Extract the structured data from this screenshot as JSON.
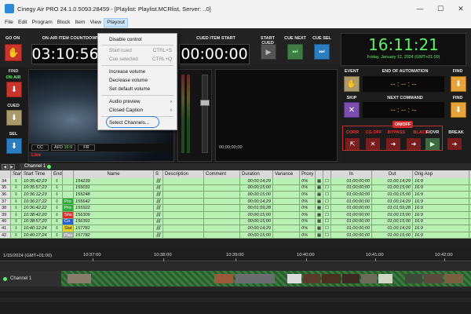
{
  "window": {
    "title": "Cinegy Air PRO 24.1.0.5093.28459 - [Playlist: Playlist.MCRlist, Server: ..0]",
    "minimize": "—",
    "maximize": "☐",
    "close": "✕"
  },
  "menu": [
    "File",
    "Edit",
    "Program",
    "Block",
    "Item",
    "View",
    "Playout"
  ],
  "toolbar": {
    "go_on": "GO ON",
    "on_air_countdown_label": "ON-AIR ITEM COUNTDOWN",
    "on_air_countdown": "03:10:56",
    "cued_start_label": "CUED ITEM START",
    "cued_start": "00:00:00",
    "start_cued": "START CUED",
    "cue_next": "CUE NEXT",
    "cue_sel": "CUE SEL",
    "clock": "16:11:21",
    "date": "Friday, January 12, 2024 (GMT+01:00)"
  },
  "playout_menu": {
    "disable_control": "Disable control",
    "start_cued": "Start cued",
    "start_cued_sc": "CTRL+S",
    "cue_selected": "Cue selected",
    "cue_selected_sc": "CTRL+Q",
    "increase_volume": "Increase volume",
    "decrease_volume": "Decrease volume",
    "set_default_volume": "Set default volume",
    "audio_preview": "Audio preview",
    "closed_caption": "Closed Caption",
    "select_channels": "Select Channels..."
  },
  "left_panel": {
    "find": "FIND",
    "on_air": "ON AIR",
    "cued": "CUED",
    "sel": "SEL",
    "live": "Live"
  },
  "preview": {
    "cc": "CC",
    "afd": "AFD",
    "afd_val": "16:9",
    "fr": "FR"
  },
  "next_monitor": {
    "timecode": "00;00;00;00"
  },
  "right_panel": {
    "event": "EVENT",
    "end_of_automation_label": "END OF AUTOMATION",
    "end_of_automation": "-- : -- : --",
    "find": "FIND",
    "skip": "SKIP",
    "next_command_label": "NEXT COMMAND",
    "next_command": "-- : -- : --",
    "find2": "FIND",
    "onoff": "ON/OFF",
    "corr": "CORR",
    "cg_off": "CG OFF",
    "bypass": "BYPASS",
    "black": "BLACK",
    "fovr": "F/OVR",
    "break": "BREAK"
  },
  "tabs": {
    "channel": "Channel 1"
  },
  "grid": {
    "headers": [
      "",
      "Star",
      "Start Time",
      "End",
      "",
      "Name",
      "S",
      "Description",
      "Comment",
      "Duration",
      "Variance",
      "Proxy",
      "",
      "",
      "In",
      "Out",
      "Orig Asp"
    ],
    "rows": [
      {
        "n": "34",
        "start": "10:35:42;23",
        "tag": "",
        "name": "154239",
        "dur": "00;00;14;29",
        "proxy": "0%",
        "in": "01;00;00;00",
        "out": "01;00;14;29",
        "asp": "16:9"
      },
      {
        "n": "35",
        "start": "10:35:57;23",
        "tag": "",
        "name": "155031",
        "dur": "00;00;15;00",
        "proxy": "0%",
        "in": "01;00;00;00",
        "out": "01;00;15;00",
        "asp": "16:9"
      },
      {
        "n": "36",
        "start": "10:36:12;23",
        "tag": "",
        "name": "155248",
        "dur": "00;00;15;00",
        "proxy": "0%",
        "in": "01;00;00;00",
        "out": "01;00;15;00",
        "asp": "16:9"
      },
      {
        "n": "37",
        "start": "10:36:27;22",
        "tag": "Pro",
        "name": "155642",
        "dur": "00;00;14;29",
        "proxy": "0%",
        "in": "01;00;00;00",
        "out": "01;00;14;29",
        "asp": "16:9"
      },
      {
        "n": "38",
        "start": "10:36:42;22",
        "tag": "Pro",
        "name": "155922",
        "dur": "00;01;59;28",
        "proxy": "0%",
        "in": "01;00;00;00",
        "out": "01;01;59;28",
        "asp": "16:9"
      },
      {
        "n": "39",
        "start": "10:38:42;20",
        "tag": "Sho",
        "name": "156309",
        "dur": "00;00;15;00",
        "proxy": "0%",
        "in": "01;00;00;00",
        "out": "01;00;15;00",
        "asp": "16:9"
      },
      {
        "n": "40",
        "start": "10:38:57;20",
        "tag": "Co",
        "name": "156391",
        "dur": "00;00;15;00",
        "proxy": "0%",
        "in": "01;00;00;00",
        "out": "01;00;15;00",
        "asp": "16:9"
      },
      {
        "n": "41",
        "start": "10:40:12;24",
        "tag": "Slat",
        "name": "157781",
        "dur": "00;00;14;29",
        "proxy": "0%",
        "in": "01;00;00;00",
        "out": "01;00;14;29",
        "asp": "16:9"
      },
      {
        "n": "42",
        "start": "10:40:27;24",
        "tag": "Pau",
        "name": "157782",
        "dur": "00;00;15;00",
        "proxy": "0%",
        "in": "01;00;00;00",
        "out": "01;00;15;00",
        "asp": "16:9"
      }
    ]
  },
  "timeline": {
    "date": "1/15/2024 (GMT+01:00)",
    "ticks": [
      "10:37:00",
      "10:38:00",
      "10:39:00",
      "10:40:00",
      "10:41:00",
      "10:42:00"
    ],
    "channel": "Channel 1"
  },
  "colors": {
    "accent_green": "#5ff06a",
    "tag_pro": "#2fae3a",
    "tag_sho": "#d8322c",
    "tag_co": "#2c60d8",
    "tag_slat": "#e8d22c",
    "tag_pau": "#aaaaaa"
  }
}
